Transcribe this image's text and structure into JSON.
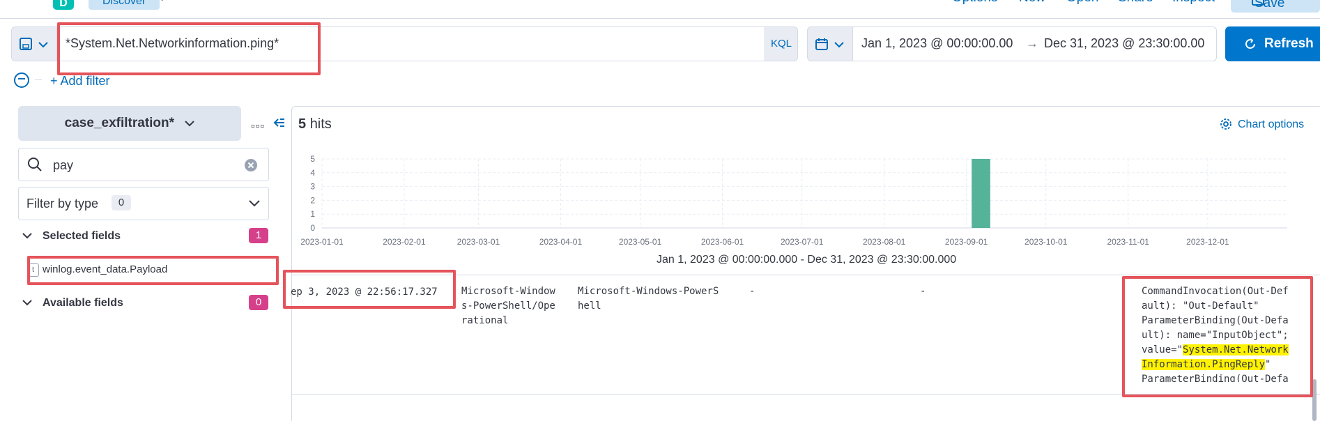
{
  "header": {
    "logo_letter": "D",
    "app_name": "Discover",
    "nav_links": [
      "Options",
      "New",
      "Open",
      "Share",
      "Inspect"
    ],
    "save_label": "Save"
  },
  "query_bar": {
    "query": "*System.Net.Networkinformation.ping*",
    "language": "KQL",
    "date_start": "Jan 1, 2023 @ 00:00:00.00",
    "date_arrow": "→",
    "date_end": "Dec 31, 2023 @ 23:30:00.00",
    "refresh_label": "Refresh",
    "add_filter_label": "+ Add filter"
  },
  "sidebar": {
    "index_pattern": "case_exfiltration*",
    "search_value": "pay",
    "filter_by_type_label": "Filter by type",
    "filter_by_type_count": "0",
    "selected_fields_label": "Selected fields",
    "selected_fields_count": "1",
    "selected_fields": [
      {
        "type_icon": "t",
        "name": "winlog.event_data.Payload"
      }
    ],
    "available_fields_label": "Available fields",
    "available_fields_count": "0"
  },
  "main": {
    "hits_count": "5",
    "hits_label": "hits",
    "chart_options_label": "Chart options",
    "time_range_label": "Jan 1, 2023 @ 00:00:00.000 - Dec 31, 2023 @ 23:30:00.000"
  },
  "chart_data": {
    "type": "bar",
    "categories": [
      "2023-01-01",
      "2023-02-01",
      "2023-03-01",
      "2023-04-01",
      "2023-05-01",
      "2023-06-01",
      "2023-07-01",
      "2023-08-01",
      "2023-09-01",
      "2023-10-01",
      "2023-11-01",
      "2023-12-01"
    ],
    "y_ticks": [
      "0",
      "1",
      "2",
      "3",
      "4",
      "5"
    ],
    "bars": [
      {
        "date": "2023-09-03",
        "value": 5
      }
    ],
    "ylim": [
      0,
      5
    ],
    "xlim": [
      "2023-01-01",
      "2023-12-31"
    ],
    "grid": true,
    "bar_color": "#54b399"
  },
  "document": {
    "timestamp": "ep 3, 2023 @ 22:56:17.327",
    "col2_lines": [
      "Microsoft-Window",
      "s-PowerShell/Ope",
      "rational"
    ],
    "col3_lines": [
      "Microsoft-Windows-PowerS",
      "hell"
    ],
    "col4": "-",
    "col5": "-",
    "payload_lines": [
      "CommandInvocation(Out-Def",
      "ault): \"Out-Default\"",
      "ParameterBinding(Out-Defa",
      "ult): name=\"InputObject\";"
    ],
    "payload_value_prefix": "value=\"",
    "payload_highlight_1": "System.Net.Network",
    "payload_highlight_2": "Information.PingReply",
    "payload_value_suffix": "\"",
    "payload_last_line": "ParameterBinding(Out-Defa"
  },
  "colors": {
    "accent": "#0077cc",
    "link": "#006bb8",
    "annotation_red": "#e5545b",
    "badge_pink": "#d6408b",
    "highlight": "#fff200"
  }
}
